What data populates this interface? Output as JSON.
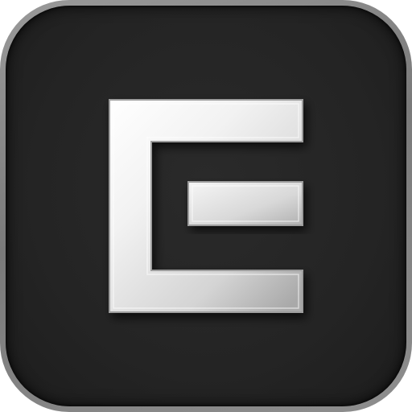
{
  "app_icon": {
    "icon_name": "letter-e-logo-icon",
    "colors": {
      "tile_background": "#232323",
      "frame_border": "#8a8a8a",
      "glyph_light": "#ffffff",
      "glyph_shade": "#a9a9a9"
    }
  }
}
